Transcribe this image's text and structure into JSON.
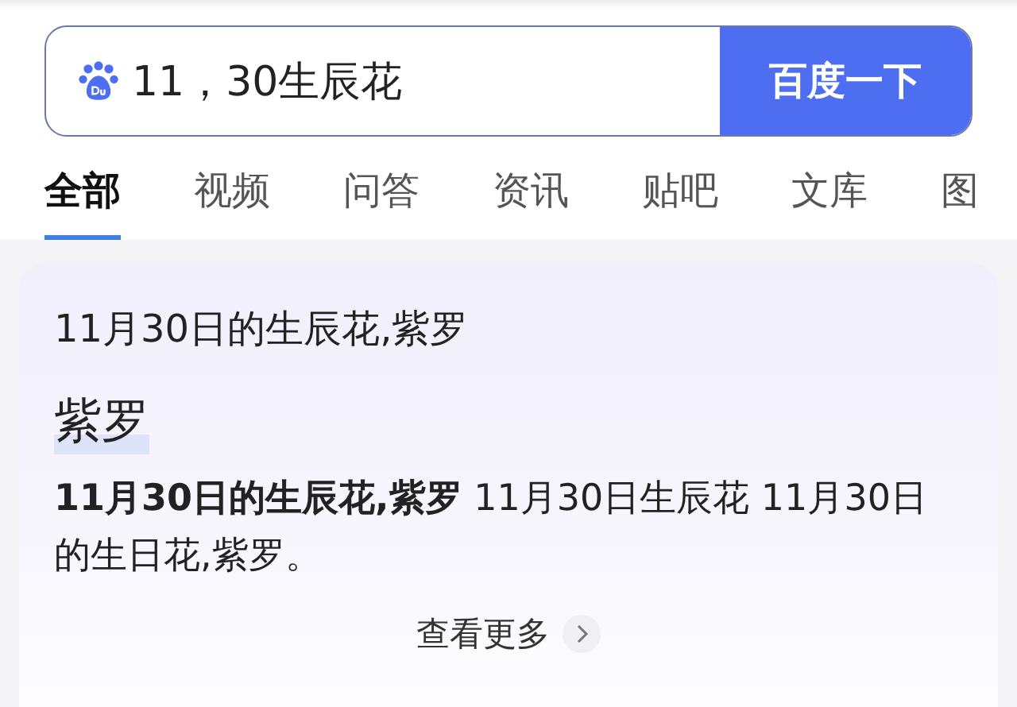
{
  "search": {
    "value": "11，30生辰花",
    "button": "百度一下"
  },
  "tabs": [
    {
      "label": "全部",
      "selected": true
    },
    {
      "label": "视频",
      "selected": false
    },
    {
      "label": "问答",
      "selected": false
    },
    {
      "label": "资讯",
      "selected": false
    },
    {
      "label": "贴吧",
      "selected": false
    },
    {
      "label": "文库",
      "selected": false
    },
    {
      "label": "图",
      "selected": false
    }
  ],
  "card": {
    "title": "11月30日的生辰花,紫罗",
    "answer": "紫罗",
    "text": "**11月30日的生辰花,紫罗** 11月30日生辰花 11月30日的生日花,紫罗。",
    "more": "查看更多"
  }
}
